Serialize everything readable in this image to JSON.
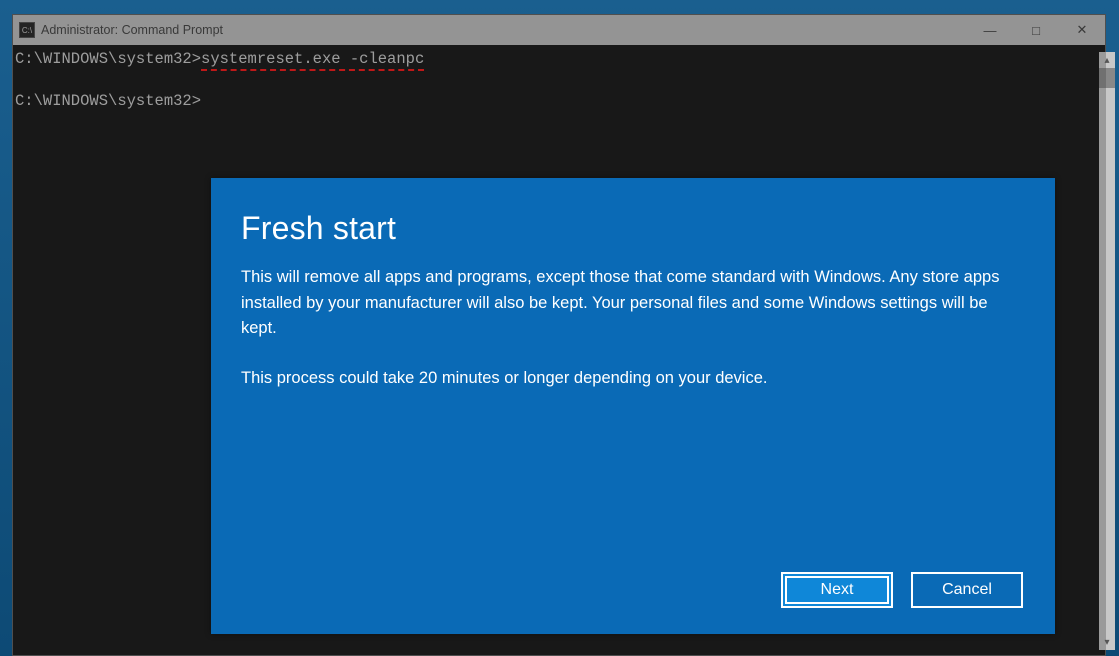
{
  "cmd": {
    "title": "Administrator: Command Prompt",
    "icon_label": "C:\\",
    "prompt1": "C:\\WINDOWS\\system32>",
    "typed": "systemreset.exe -cleanpc",
    "prompt2": "C:\\WINDOWS\\system32>",
    "controls": {
      "min": "—",
      "max": "□",
      "close": "✕"
    },
    "scroll": {
      "up": "▴",
      "down": "▾"
    }
  },
  "dialog": {
    "title": "Fresh start",
    "para1": "This will remove all apps and programs, except those that come standard with Windows. Any store apps installed by your manufacturer will also be kept. Your personal files and some Windows settings will be kept.",
    "para2": "This process could take 20 minutes or longer depending on your device.",
    "next_label": "Next",
    "cancel_label": "Cancel"
  }
}
